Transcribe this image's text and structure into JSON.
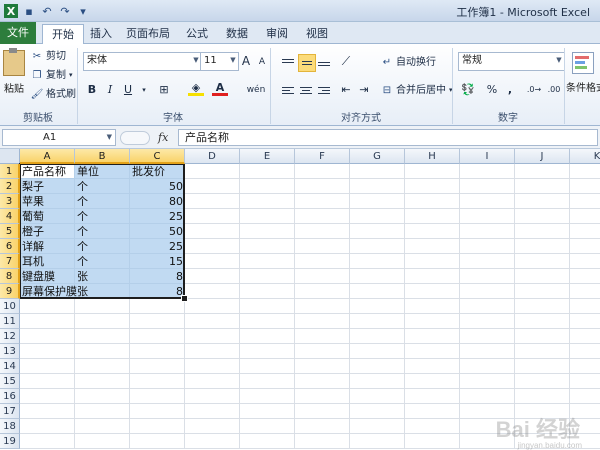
{
  "window": {
    "title": "工作簿1 - Microsoft Excel"
  },
  "quick_access": {
    "items": [
      {
        "name": "excel-logo-icon",
        "glyph": "X"
      },
      {
        "name": "save-icon",
        "glyph": "▪"
      },
      {
        "name": "undo-icon",
        "glyph": "↶"
      },
      {
        "name": "redo-icon",
        "glyph": "↷"
      },
      {
        "name": "customize-qat-icon",
        "glyph": "▾"
      }
    ]
  },
  "tabs": [
    "文件",
    "开始",
    "插入",
    "页面布局",
    "公式",
    "数据",
    "审阅",
    "视图"
  ],
  "ribbon": {
    "clipboard": {
      "paste": "粘贴",
      "cut": "剪切",
      "copy": "复制",
      "format_painter": "格式刷",
      "label": "剪贴板"
    },
    "font": {
      "name": "宋体",
      "size": "11",
      "grow": "A",
      "shrink": "A",
      "bold": "B",
      "italic": "I",
      "underline": "U",
      "phonetic": "wén",
      "label": "字体"
    },
    "alignment": {
      "wrap_text": "自动换行",
      "merge_center": "合并后居中",
      "label": "对齐方式"
    },
    "number": {
      "format": "常规",
      "percent": "%",
      "comma": ",",
      "label": "数字"
    },
    "styles": {
      "conditional": "条件格式"
    }
  },
  "formula_bar": {
    "name_box": "A1",
    "fx": "fx",
    "value": "产品名称"
  },
  "sheet": {
    "columns": [
      "A",
      "B",
      "C",
      "D",
      "E",
      "F",
      "G",
      "H",
      "I",
      "J",
      "K"
    ],
    "selected_columns": [
      "A",
      "B",
      "C"
    ],
    "rows": [
      "1",
      "2",
      "3",
      "4",
      "5",
      "6",
      "7",
      "8",
      "9",
      "10",
      "11",
      "12",
      "13",
      "14",
      "15",
      "16",
      "17",
      "18",
      "19"
    ],
    "selected_rows": [
      "1",
      "2",
      "3",
      "4",
      "5",
      "6",
      "7",
      "8",
      "9"
    ],
    "cells": [
      [
        "产品名称",
        "单位",
        "批发价"
      ],
      [
        "梨子",
        "个",
        "50"
      ],
      [
        "苹果",
        "个",
        "80"
      ],
      [
        "葡萄",
        "个",
        "25"
      ],
      [
        "橙子",
        "个",
        "50"
      ],
      [
        "详解",
        "个",
        "25"
      ],
      [
        "耳机",
        "个",
        "15"
      ],
      [
        "键盘膜",
        "张",
        "8"
      ],
      [
        "屏幕保护膜",
        "张",
        "8"
      ]
    ]
  },
  "watermark": {
    "text": "Bai 经验",
    "sub": "jingyan.baidu.com"
  }
}
